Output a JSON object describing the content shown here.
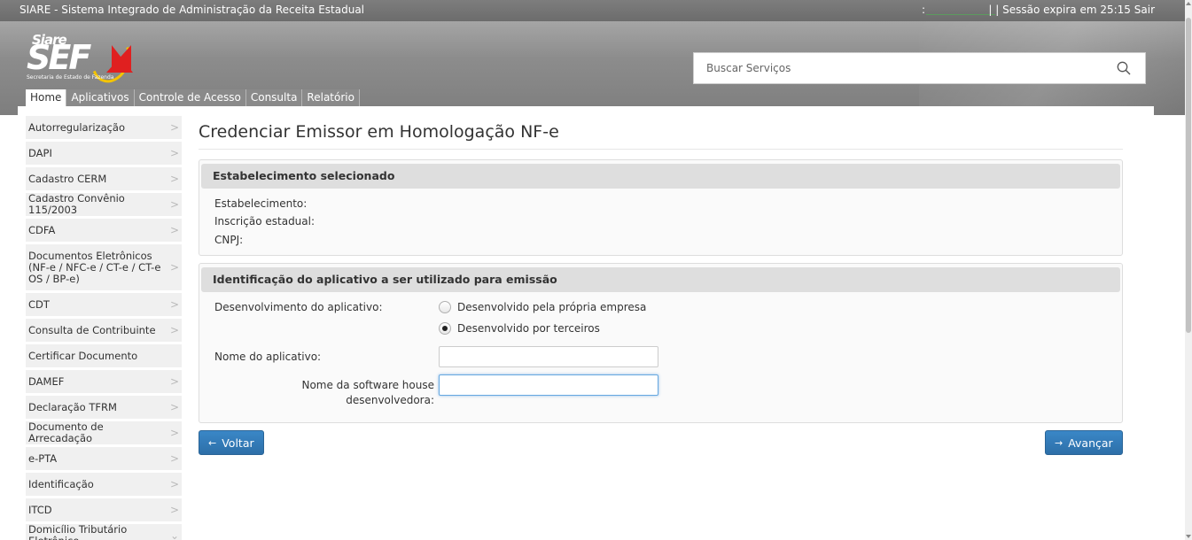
{
  "topbar": {
    "title": "SIARE - Sistema Integrado de Administração da Receita Estadual",
    "colon": ":",
    "session": "| | Sessão expira em 25:15 Sair"
  },
  "logo": {
    "siare": "Siare",
    "sef": "SEF",
    "subtitle": "Secretaria de Estado de Fazenda"
  },
  "search": {
    "placeholder": "Buscar Serviços",
    "icon": "search-icon"
  },
  "nav": {
    "tabs": [
      {
        "label": "Home"
      },
      {
        "label": "Aplicativos"
      },
      {
        "label": "Controle de Acesso"
      },
      {
        "label": "Consulta"
      },
      {
        "label": "Relatório"
      }
    ]
  },
  "sidebar": {
    "items": [
      {
        "label": "Autorregularização",
        "chevron": ">"
      },
      {
        "label": "DAPI",
        "chevron": ">"
      },
      {
        "label": "Cadastro CERM",
        "chevron": ">"
      },
      {
        "label": "Cadastro Convênio 115/2003",
        "chevron": ">"
      },
      {
        "label": "CDFA",
        "chevron": ">"
      },
      {
        "label": "Documentos Eletrônicos\n(NF-e / NFC-e / CT-e / CT-e\nOS / BP-e)",
        "chevron": ">"
      },
      {
        "label": "CDT",
        "chevron": ">"
      },
      {
        "label": "Consulta de Contribuinte",
        "chevron": ">"
      },
      {
        "label": "Certificar Documento",
        "chevron": ""
      },
      {
        "label": "DAMEF",
        "chevron": ">"
      },
      {
        "label": "Declaração TFRM",
        "chevron": ">"
      },
      {
        "label": "Documento de Arrecadação",
        "chevron": ">"
      },
      {
        "label": "e-PTA",
        "chevron": ">"
      },
      {
        "label": "Identificação",
        "chevron": ">"
      },
      {
        "label": "ITCD",
        "chevron": ">"
      },
      {
        "label": "Domicílio Tributário Eletrônico",
        "chevron": "⌄"
      }
    ]
  },
  "main": {
    "title": "Credenciar Emissor em Homologação NF-e",
    "establishment": {
      "header": "Estabelecimento selecionado",
      "estab_label": "Estabelecimento:",
      "ie_label": "Inscrição estadual:",
      "cnpj_label": "CNPJ:"
    },
    "app": {
      "header": "Identificação do aplicativo a ser utilizado para emissão",
      "dev_label": "Desenvolvimento do aplicativo:",
      "radio_own": "Desenvolvido pela própria empresa",
      "radio_third": "Desenvolvido por terceiros",
      "selected": "Desenvolvido por terceiros",
      "name_label": "Nome do aplicativo:",
      "name_value": "",
      "softhouse_label_1": "Nome da software house",
      "softhouse_label_2": "desenvolvedora:",
      "softhouse_value": ""
    },
    "buttons": {
      "back": "Voltar",
      "back_arrow": "←",
      "next": "Avançar",
      "next_arrow": "→"
    }
  },
  "colors": {
    "topbar": "#727272",
    "button": "#337ab7",
    "panel_header": "#dedede",
    "logo_red": "#e02020",
    "logo_yellow": "#f4c400"
  }
}
